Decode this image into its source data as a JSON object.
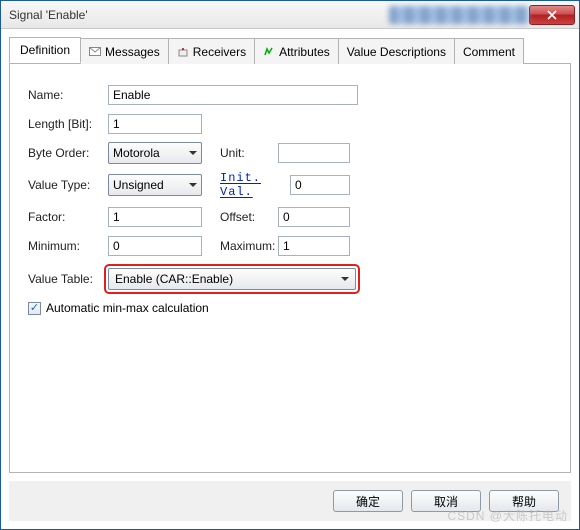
{
  "window": {
    "title": "Signal 'Enable'"
  },
  "tabs": {
    "definition": "Definition",
    "messages": "Messages",
    "receivers": "Receivers",
    "attributes": "Attributes",
    "value_descriptions": "Value Descriptions",
    "comment": "Comment"
  },
  "form": {
    "name_label": "Name:",
    "name_value": "Enable",
    "length_label": "Length [Bit]:",
    "length_value": "1",
    "byteorder_label": "Byte Order:",
    "byteorder_value": "Motorola",
    "unit_label": "Unit:",
    "unit_value": "",
    "valuetype_label": "Value Type:",
    "valuetype_value": "Unsigned",
    "initval_label": "Init. Val.",
    "initval_value": "0",
    "factor_label": "Factor:",
    "factor_value": "1",
    "offset_label": "Offset:",
    "offset_value": "0",
    "minimum_label": "Minimum:",
    "minimum_value": "0",
    "maximum_label": "Maximum:",
    "maximum_value": "1",
    "valuetable_label": "Value Table:",
    "valuetable_value": "Enable (CAR::Enable)",
    "autominmax_label": "Automatic min-max calculation"
  },
  "buttons": {
    "ok": "确定",
    "cancel": "取消",
    "help": "帮助"
  },
  "watermark": "CSDN @大陈托电动"
}
